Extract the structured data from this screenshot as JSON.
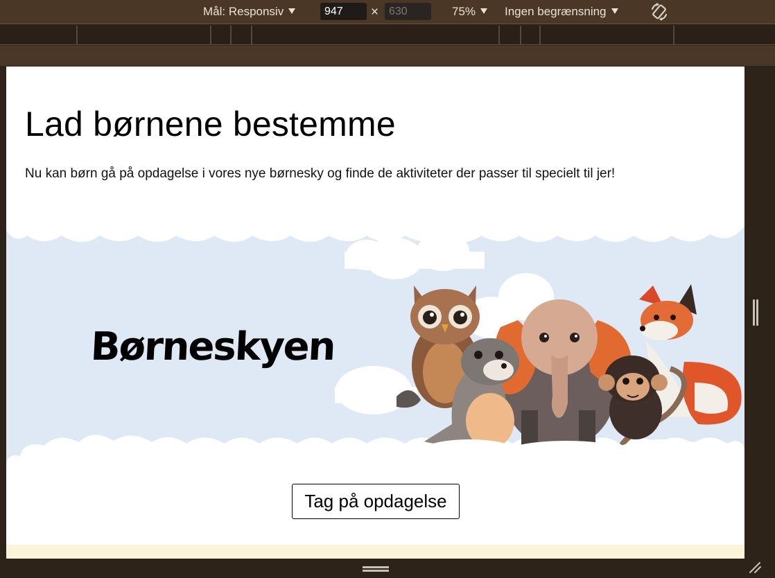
{
  "devtools": {
    "target_label": "Mål: Responsiv",
    "width_value": "947",
    "height_value": "630",
    "dimension_separator": "×",
    "zoom_label": "75%",
    "throttle_label": "Ingen begrænsning"
  },
  "page": {
    "title": "Lad børnene bestemme",
    "description": "Nu kan børn gå på opdagelse i vores nye børnesky og finde de aktiviteter der passer til specielt til jer!",
    "banner_logo": "Børneskyen",
    "cta_label": "Tag på opdagelse"
  },
  "colors": {
    "sky": "#dfe9f6",
    "toolbar": "#4a3726",
    "frame": "#2e2318",
    "footer_band": "#fcf4d8"
  },
  "icons": [
    "caret-down-icon",
    "rotate-device-icon",
    "resize-handle-icon"
  ]
}
